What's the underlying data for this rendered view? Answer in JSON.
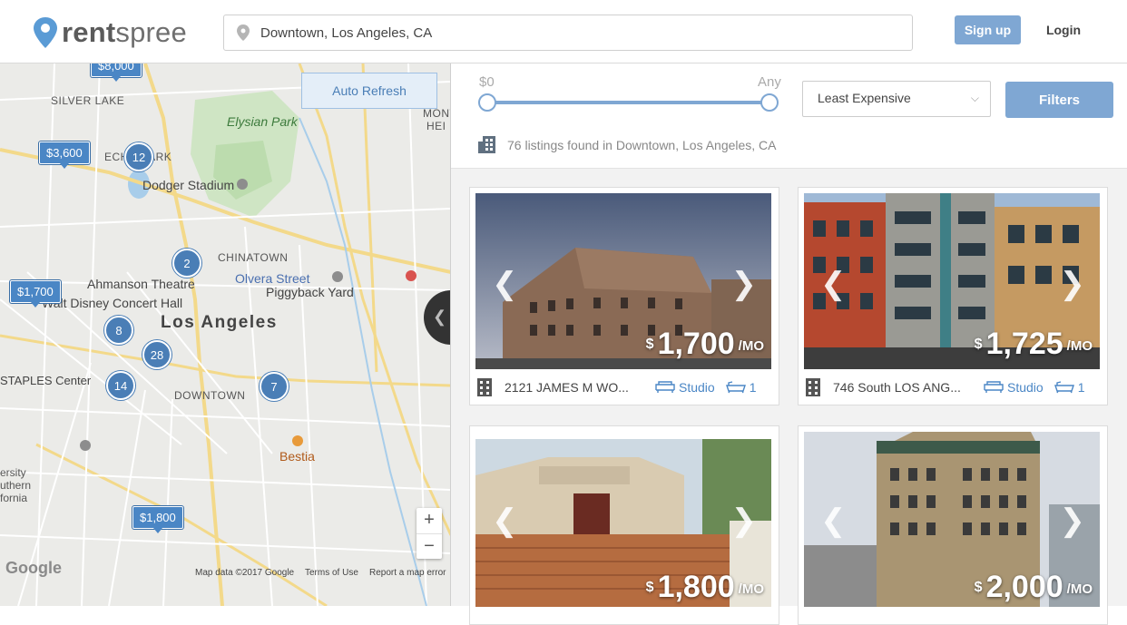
{
  "header": {
    "logo_bold": "rent",
    "logo_light": "spree",
    "search_value": "Downtown, Los Angeles, CA",
    "signup_label": "Sign up",
    "login_label": "Login"
  },
  "map": {
    "auto_refresh_label": "Auto Refresh",
    "labels": {
      "silver_lake": "SILVER LAKE",
      "echo_park": "ECHO PARK",
      "elysian_park": "Elysian Park",
      "dodger_stadium": "Dodger Stadium",
      "chinatown": "CHINATOWN",
      "olvera_street": "Olvera Street",
      "piggyback_yard": "Piggyback Yard",
      "ahmanson_theatre": "Ahmanson Theatre",
      "walt_disney": "Walt Disney Concert Hall",
      "los_angeles": "Los Angeles",
      "staples_center": "STAPLES Center",
      "downtown": "DOWNTOWN",
      "bestia": "Bestia",
      "university": "ersity",
      "southern": "uthern",
      "california": "fornia",
      "montecito": "MONT",
      "heights": "HEI"
    },
    "price_pins": [
      "$8,000",
      "$3,600",
      "$1,700",
      "$1,800"
    ],
    "clusters": [
      "12",
      "2",
      "8",
      "28",
      "14",
      "7"
    ],
    "zoom_in": "+",
    "zoom_out": "−",
    "google_logo": "Google",
    "footer": {
      "map_data": "Map data ©2017 Google",
      "terms": "Terms of Use",
      "report": "Report a map error"
    }
  },
  "filters": {
    "price_min": "$0",
    "price_max": "Any",
    "sort_value": "Least Expensive",
    "filters_label": "Filters",
    "results_text": "76 listings found in Downtown, Los Angeles, CA"
  },
  "listings": [
    {
      "price": "1,700",
      "currency": "$",
      "unit": "/MO",
      "address": "2121 JAMES M WO...",
      "type": "Studio",
      "baths": "1"
    },
    {
      "price": "1,725",
      "currency": "$",
      "unit": "/MO",
      "address": "746 South LOS ANG...",
      "type": "Studio",
      "baths": "1"
    },
    {
      "price": "1,800",
      "currency": "$",
      "unit": "/MO"
    },
    {
      "price": "2,000",
      "currency": "$",
      "unit": "/MO"
    }
  ],
  "colors": {
    "accent": "#7fa7d3",
    "pin": "#4a86c5",
    "cluster": "#4a7eb6"
  }
}
